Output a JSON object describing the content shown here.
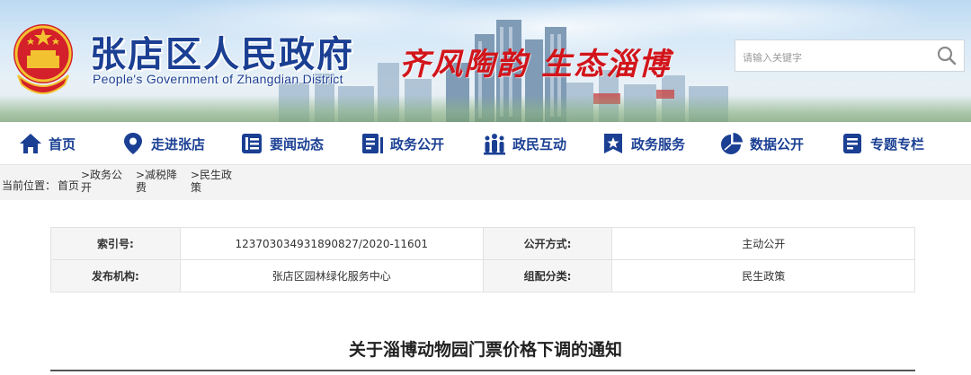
{
  "header": {
    "title": "张店区人民政府",
    "subtitle": "People's Government of Zhangdian District",
    "slogan_left": "齐风陶韵",
    "slogan_right": "生态淄博",
    "search_placeholder": "请输入关键字",
    "brand_color": "#1a3f93",
    "slogan_color": "#d2151b"
  },
  "nav": {
    "items": [
      {
        "label": "首页",
        "icon": "home-icon"
      },
      {
        "label": "走进张店",
        "icon": "location-pin-icon"
      },
      {
        "label": "要闻动态",
        "icon": "news-list-icon"
      },
      {
        "label": "政务公开",
        "icon": "document-icon"
      },
      {
        "label": "政民互动",
        "icon": "people-icon"
      },
      {
        "label": "政务服务",
        "icon": "star-badge-icon"
      },
      {
        "label": "数据公开",
        "icon": "pie-chart-icon"
      },
      {
        "label": "专题专栏",
        "icon": "topic-icon"
      }
    ]
  },
  "breadcrumb": {
    "label": "当前位置：",
    "home": "首页",
    "crumbs": [
      ">政务公开",
      ">减税降费",
      ">民生政策"
    ]
  },
  "meta": {
    "index_no_label": "索引号:",
    "index_no": "123703034931890827/2020-11601",
    "public_method_label": "公开方式:",
    "public_method": "主动公开",
    "publisher_label": "发布机构:",
    "publisher": "张店区园林绿化服务中心",
    "category_label": "组配分类:",
    "category": "民生政策"
  },
  "document": {
    "title": "关于淄博动物园门票价格下调的通知"
  }
}
